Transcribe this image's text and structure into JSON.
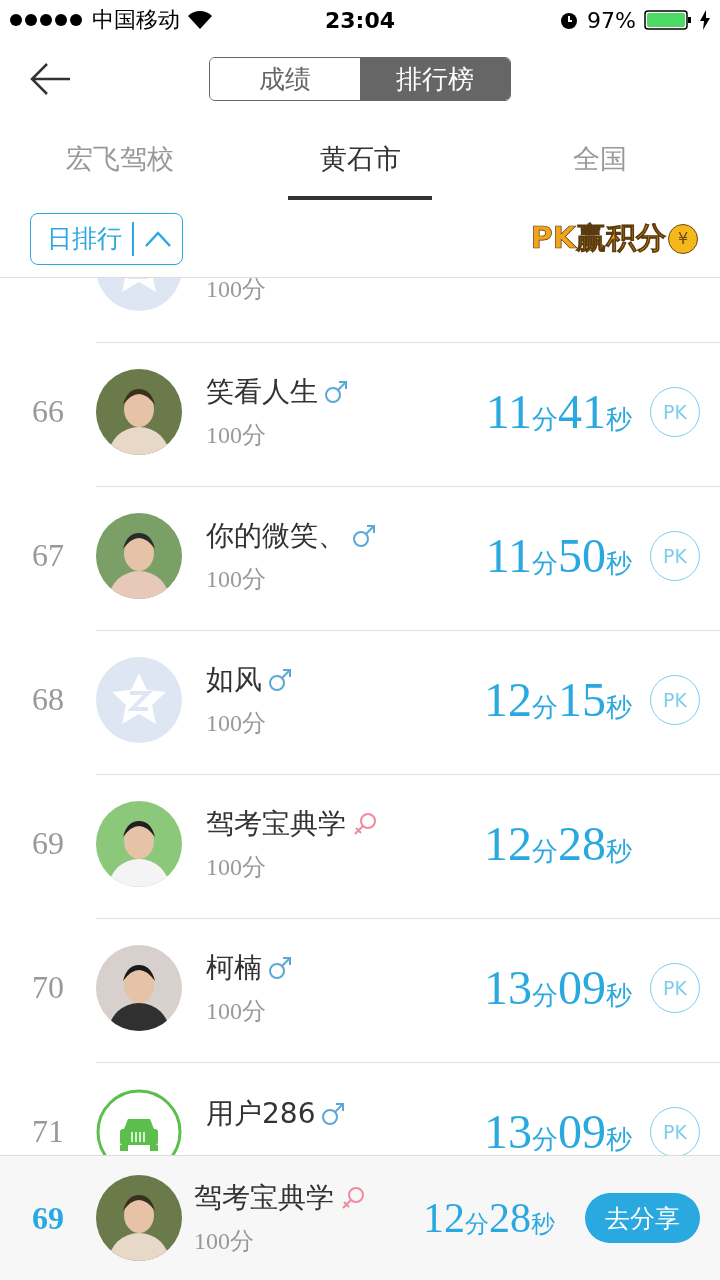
{
  "status_bar": {
    "carrier": "中国移动",
    "time": "23:04",
    "battery": "97%"
  },
  "segments": [
    {
      "label": "成绩",
      "selected": false
    },
    {
      "label": "排行榜",
      "selected": true
    }
  ],
  "tabs": [
    {
      "label": "宏飞驾校",
      "selected": false
    },
    {
      "label": "黄石市",
      "selected": true
    },
    {
      "label": "全国",
      "selected": false
    }
  ],
  "filter": {
    "label": "日排行",
    "expanded": true
  },
  "banner": {
    "text": "PK赢积分",
    "coin": "¥"
  },
  "rows": [
    {
      "avatar": {
        "kind": "default"
      },
      "score": "100分"
    },
    {
      "rank": "66",
      "name": "笑看人生",
      "gender": {
        "kind": "male"
      },
      "score": "100分",
      "time": "11分41秒",
      "pk": "PK"
    },
    {
      "rank": "67",
      "name": "你的微笑、",
      "gender": {
        "kind": "male"
      },
      "score": "100分",
      "time": "11分50秒",
      "pk": "PK"
    },
    {
      "rank": "68",
      "avatar": {
        "kind": "default"
      },
      "name": "如风",
      "gender": {
        "kind": "male"
      },
      "score": "100分",
      "time": "12分15秒",
      "pk": "PK"
    },
    {
      "rank": "69",
      "name": "驾考宝典学",
      "gender": {
        "kind": "female"
      },
      "score": "100分",
      "time": "12分28秒"
    },
    {
      "rank": "70",
      "name": "柯楠",
      "gender": {
        "kind": "male"
      },
      "score": "100分",
      "time": "13分09秒",
      "pk": "PK"
    },
    {
      "rank": "71",
      "avatar": {
        "kind": "car"
      },
      "name": "用户286",
      "gender": {
        "kind": "male"
      },
      "time": "13分09秒",
      "pk": "PK"
    }
  ],
  "me": {
    "rank": "69",
    "name": "驾考宝典学",
    "gender": {
      "kind": "female"
    },
    "score": "100分",
    "time": "12分28秒",
    "share": "去分享"
  }
}
